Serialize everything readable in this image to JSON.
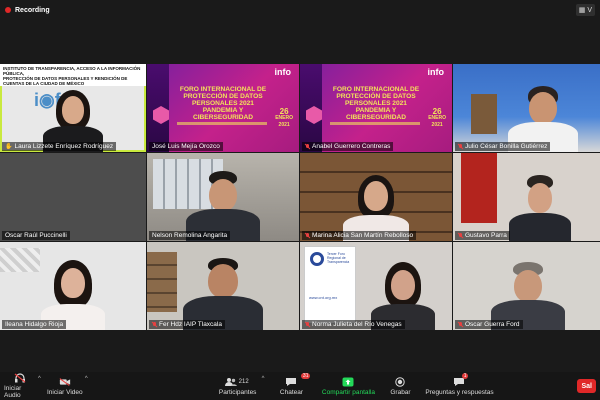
{
  "topbar": {
    "recording_label": "Recording",
    "view_label": "V"
  },
  "participants": [
    {
      "name": "Laura Lizzete Enríquez Rodríguez",
      "muted": false,
      "active": true
    },
    {
      "name": "José Luis Mejía Orozco",
      "muted": false
    },
    {
      "name": "Anabel Guerrero Contreras",
      "muted": true
    },
    {
      "name": "Julio César Bonilla Gutiérrez",
      "muted": true
    },
    {
      "name": "Oscar Raúl Puccinelli",
      "muted": false
    },
    {
      "name": "Nelson Remolina Angarita",
      "muted": false
    },
    {
      "name": "Marina Alicia San Martín Rebolloso",
      "muted": true
    },
    {
      "name": "Gustavo Parra",
      "muted": true
    },
    {
      "name": "Ileana Hidalgo Rioja",
      "muted": false
    },
    {
      "name": "Fer Hdz IAIP Tlaxcala",
      "muted": true
    },
    {
      "name": "Norma Julieta del Río Venegas",
      "muted": true
    },
    {
      "name": "Oscar Guerra Ford",
      "muted": true
    }
  ],
  "banner": {
    "line1": "INSTITUTO DE TRANSPARENCIA, ACCESO A LA INFORMACIÓN PÚBLICA,",
    "line2": "PROTECCIÓN DE DATOS PERSONALES Y RENDICIÓN DE CUENTAS DE LA CIUDAD DE MÉXICO"
  },
  "slide": {
    "logo": "info",
    "title": "FORO INTERNACIONAL DE PROTECCIÓN DE DATOS PERSONALES 2021 PANDEMIA Y CIBERSEGURIDAD",
    "day": "26",
    "month": "ENERO",
    "year": "2021"
  },
  "poster": {
    "title": "Tercer Foro Regional de Transparencia",
    "url": "www.cnt.org.mx"
  },
  "toolbar": {
    "audio_label": "Iniciar Audio",
    "video_label": "Iniciar Video",
    "participants_label": "Participantes",
    "participants_count": "212",
    "chat_label": "Chatear",
    "chat_badge": "31",
    "share_label": "Compartir pantalla",
    "record_label": "Grabar",
    "qa_label": "Preguntas y respuestas",
    "qa_badge": "1",
    "end_label": "Sal"
  },
  "colors": {
    "active_border": "#c9e93e",
    "slide_magenta": "#c4218b",
    "share_green": "#23d959",
    "end_red": "#e02828"
  }
}
